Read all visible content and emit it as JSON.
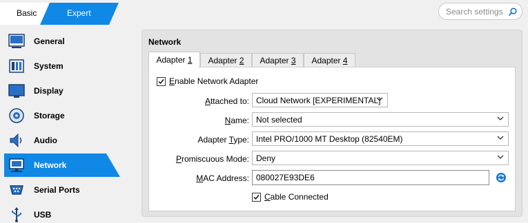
{
  "mode": {
    "basic_label": "Basic",
    "expert_label": "Expert",
    "selected": "Expert"
  },
  "search": {
    "placeholder": "Search settings"
  },
  "sidebar": {
    "items": [
      {
        "label": "General",
        "icon": "general-icon"
      },
      {
        "label": "System",
        "icon": "system-icon"
      },
      {
        "label": "Display",
        "icon": "display-icon"
      },
      {
        "label": "Storage",
        "icon": "storage-icon"
      },
      {
        "label": "Audio",
        "icon": "audio-icon"
      },
      {
        "label": "Network",
        "icon": "network-icon",
        "selected": true
      },
      {
        "label": "Serial Ports",
        "icon": "serial-ports-icon"
      },
      {
        "label": "USB",
        "icon": "usb-icon"
      }
    ]
  },
  "network": {
    "title": "Network",
    "tabs": [
      {
        "label_pre": "Adapter ",
        "label_u": "1"
      },
      {
        "label_pre": "Adapter ",
        "label_u": "2"
      },
      {
        "label_pre": "Adapter ",
        "label_u": "3"
      },
      {
        "label_pre": "Adapter ",
        "label_u": "4"
      }
    ],
    "enable": {
      "label_u": "E",
      "label_rest": "nable Network Adapter",
      "checked": true
    },
    "attached": {
      "label_u": "A",
      "label_rest": "ttached to:",
      "value": "Cloud Network [EXPERIMENTAL]"
    },
    "name": {
      "label_u": "N",
      "label_rest": "ame:",
      "value": "Not selected"
    },
    "adapter_type": {
      "label_pre": "Adapter ",
      "label_u": "T",
      "label_rest": "ype:",
      "value": "Intel PRO/1000 MT Desktop (82540EM)"
    },
    "promiscuous": {
      "label_u": "P",
      "label_rest": "romiscuous Mode:",
      "value": "Deny"
    },
    "mac": {
      "label_pre": "",
      "label_u": "M",
      "label_rest": "AC Address:",
      "value": "080027E93DE6"
    },
    "cable": {
      "label_u": "C",
      "label_rest": "able Connected",
      "checked": true
    }
  },
  "colors": {
    "accent": "#0a84e0",
    "selected_bg": "#1088e6"
  }
}
